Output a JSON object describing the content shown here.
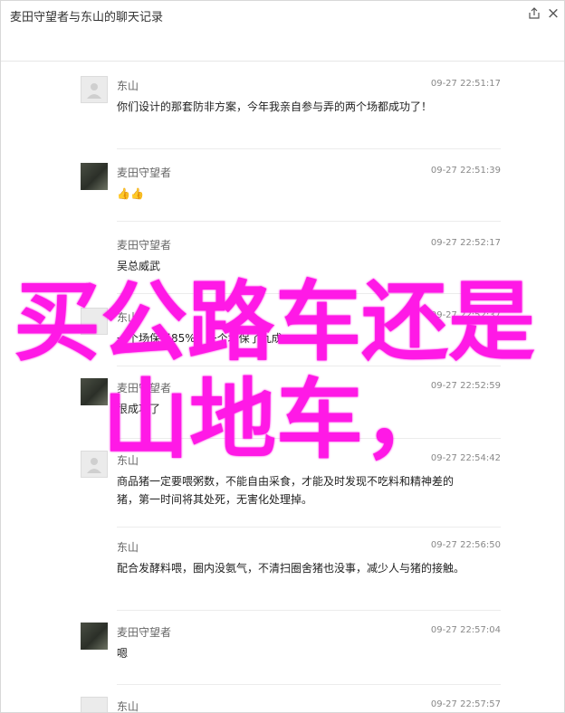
{
  "window": {
    "title": "麦田守望者与东山的聊天记录"
  },
  "messages": [
    {
      "sender": "东山",
      "time": "09-27 22:51:17",
      "text": "你们设计的那套防非方案，今年我亲自参与弄的两个场都成功了！",
      "avatar": "default"
    },
    {
      "sender": "麦田守望者",
      "time": "09-27 22:51:39",
      "text": "👍👍",
      "avatar": "photo"
    },
    {
      "sender": "麦田守望者",
      "time": "09-27 22:52:17",
      "text": "吴总威武",
      "avatar": "none"
    },
    {
      "sender": "东山",
      "time": "09-27 22:52:37",
      "text": "一个场保了85%，一个场保了九成",
      "avatar": "default"
    },
    {
      "sender": "麦田守望者",
      "time": "09-27 22:52:59",
      "text": "很成功了",
      "avatar": "photo"
    },
    {
      "sender": "东山",
      "time": "09-27 22:54:42",
      "text": "商品猪一定要喂粥数，不能自由采食，才能及时发现不吃料和精神差的猪，第一时间将其处死，无害化处理掉。",
      "avatar": "default"
    },
    {
      "sender": "东山",
      "time": "09-27 22:56:50",
      "text": "配合发酵料喂，圈内没氨气，不清扫圈舍猪也没事，减少人与猪的接触。",
      "avatar": "none"
    },
    {
      "sender": "麦田守望者",
      "time": "09-27 22:57:04",
      "text": "嗯",
      "avatar": "photo"
    },
    {
      "sender": "东山",
      "time": "09-27 22:57:57",
      "text": "",
      "avatar": "default"
    }
  ],
  "overlay": {
    "line1": "买公路车还是",
    "line2": "山地车，"
  },
  "colors": {
    "overlay_text": "#ff19e6",
    "divider": "#ececec"
  },
  "icons": {
    "export": "export-icon",
    "close": "close-icon"
  }
}
